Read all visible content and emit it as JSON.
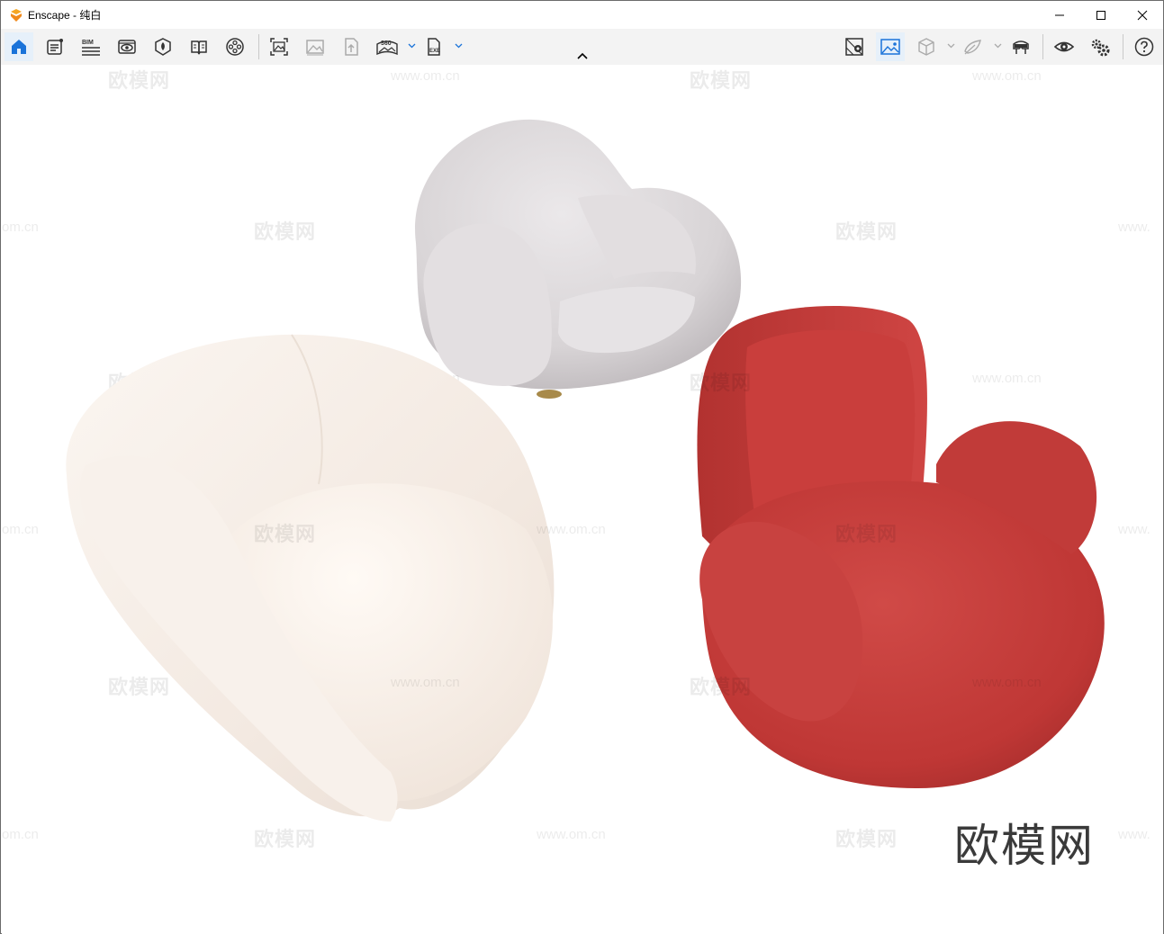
{
  "window": {
    "title": "Enscape - 纯白",
    "controls": [
      "minimize-icon",
      "maximize-icon",
      "close-icon"
    ]
  },
  "toolbar": {
    "left_tools": [
      "home-icon",
      "notes-icon",
      "bim-icon",
      "visual-settings-icon",
      "asset-library-icon",
      "material-editor-icon",
      "video-editor-icon",
      "screenshot-icon",
      "batch-render-icon",
      "upload-icon",
      "panorama-icon",
      "standalone-exe-icon"
    ],
    "bim_label": "BIM",
    "panorama_label": "360",
    "exe_label": "EXE",
    "right_tools": [
      "view-management-icon",
      "sync-views-icon",
      "orthographic-icon",
      "section-icon",
      "vr-headset-icon",
      "live-updates-icon",
      "settings-icon",
      "help-icon"
    ]
  },
  "viewport": {
    "watermark_text": "欧模网",
    "watermark_url": "www.om.cn",
    "watermark_url_cut": "om.cn",
    "watermark_url_edge": "www.",
    "logo_text": "欧模网"
  },
  "colors": {
    "accent": "#1a73d9",
    "logo_orange": "#f08a1d",
    "white_chair": "#f6ede6",
    "grey_chair": "#dcd9db",
    "red_chair": "#c63a38"
  }
}
